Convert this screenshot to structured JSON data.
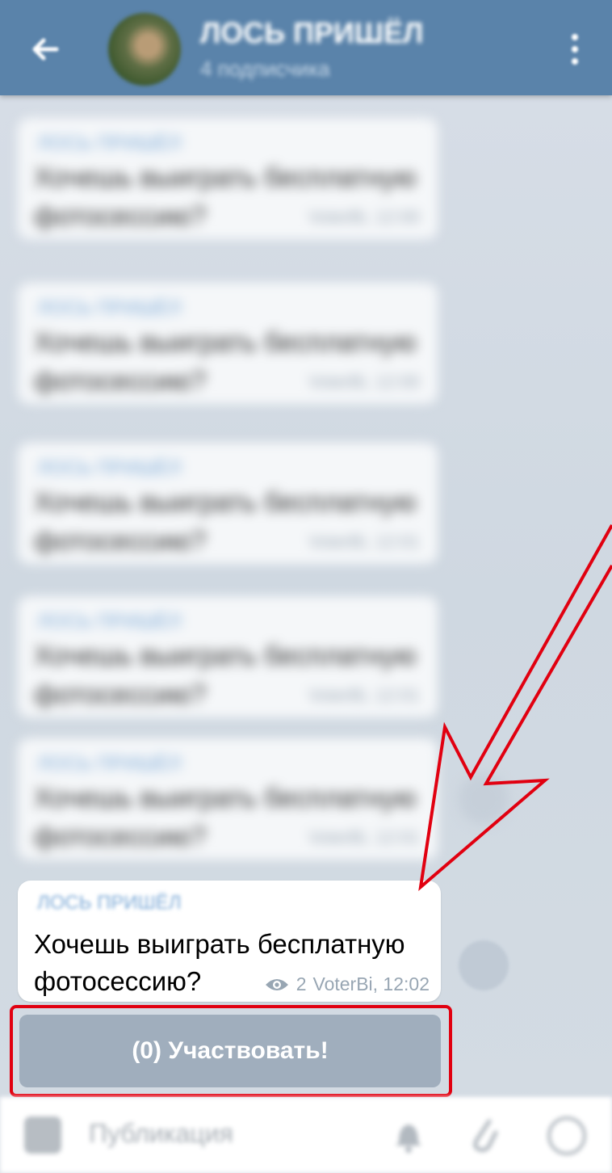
{
  "header": {
    "title": "ЛОСЬ ПРИШЁЛ",
    "subtitle": "4 подписчика",
    "back_icon": "arrow-left-icon",
    "menu_icon": "more-vertical-icon"
  },
  "blurred_messages": [
    {
      "author": "ЛОСЬ ПРИШЁЛ",
      "text": "Хочешь выиграть бесплатную фотосессию?",
      "meta": "VoterBi, 12:00"
    },
    {
      "author": "ЛОСЬ ПРИШЁЛ",
      "text": "Хочешь выиграть бесплатную фотосессию?",
      "meta": "VoterBi, 12:00"
    },
    {
      "author": "ЛОСЬ ПРИШЁЛ",
      "text": "Хочешь выиграть бесплатную фотосессию?",
      "meta": "VoterBi, 12:01"
    },
    {
      "author": "ЛОСЬ ПРИШЁЛ",
      "text": "Хочешь выиграть бесплатную фотосессию?",
      "meta": "VoterBi, 12:01"
    },
    {
      "author": "ЛОСЬ ПРИШЁЛ",
      "text": "Хочешь выиграть бесплатную фотосессию?",
      "meta": "VoterBi, 12:01"
    }
  ],
  "message": {
    "author": "ЛОСЬ ПРИШЁЛ",
    "text": "Хочешь выиграть бесплатную фотосессию?",
    "views": "2",
    "signature_time": "VoterBi, 12:02"
  },
  "inline_button": {
    "label": "(0) Участвовать!"
  },
  "input_bar": {
    "placeholder": "Публикация"
  },
  "colors": {
    "header": "#5a83aa",
    "chat_bg": "#d6dde6",
    "button": "#a0aebd",
    "annotation": "#e10010",
    "author": "#7aa8d6"
  }
}
